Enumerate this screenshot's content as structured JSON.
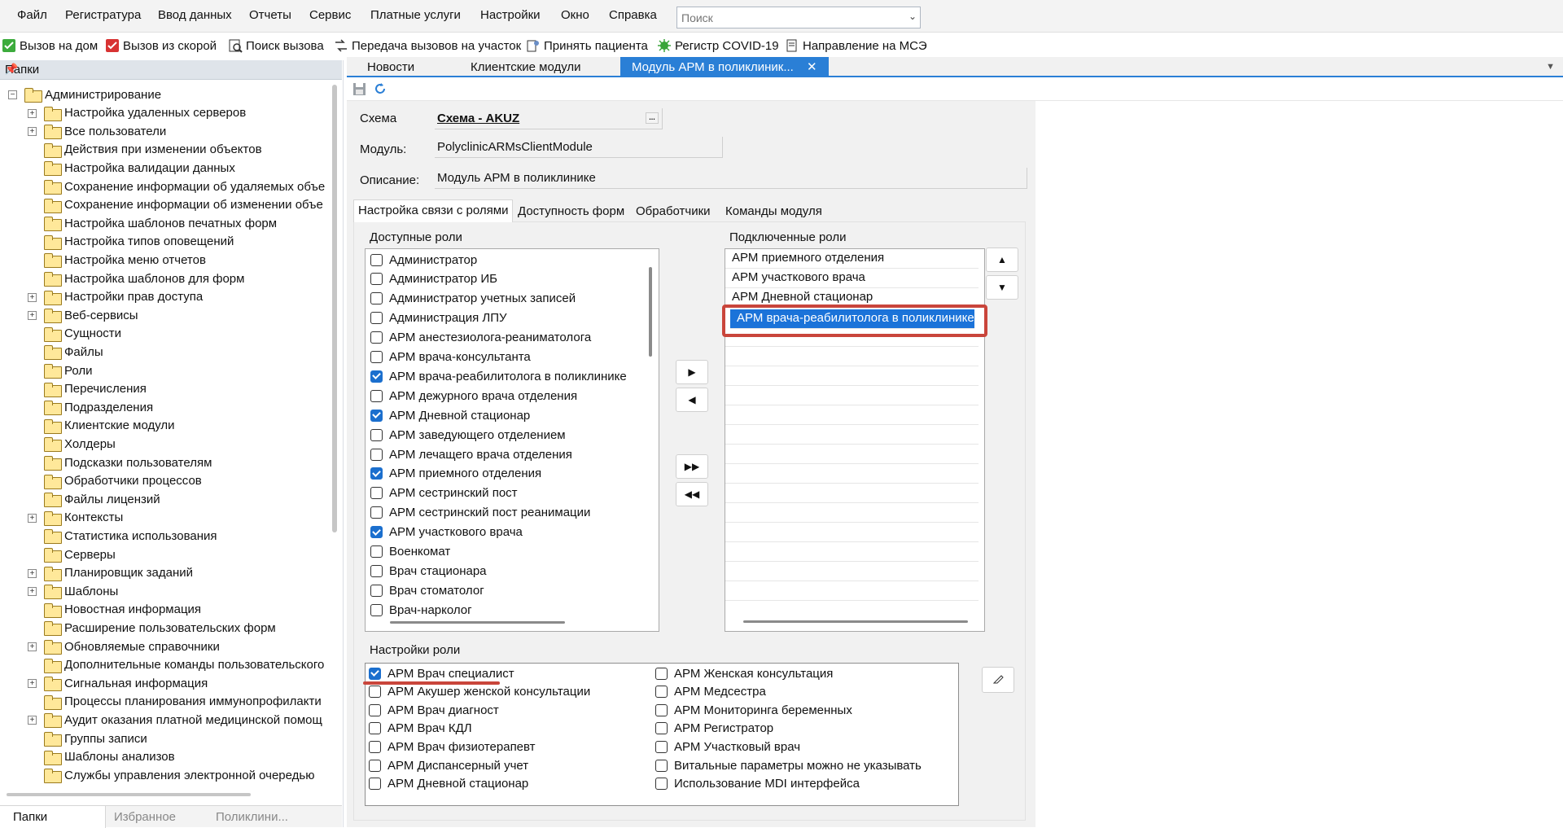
{
  "menu": [
    "Файл",
    "Регистратура",
    "Ввод данных",
    "Отчеты",
    "Сервис",
    "Платные услуги",
    "Настройки",
    "Окно",
    "Справка"
  ],
  "search": {
    "placeholder": "Поиск"
  },
  "toolbar": [
    {
      "label": "Вызов на дом",
      "icon": "house-check-icon",
      "color": "#3cab3c"
    },
    {
      "label": "Вызов из скорой",
      "icon": "ambulance-icon",
      "color": "#d83333"
    },
    {
      "label": "Поиск вызова",
      "icon": "search-document-icon",
      "color": "#3a3a3a"
    },
    {
      "label": "Передача вызовов на участок",
      "icon": "transfer-icon",
      "color": "#3a3a3a"
    },
    {
      "label": "Принять пациента",
      "icon": "accept-patient-icon",
      "color": "#3a3a3a"
    },
    {
      "label": "Регистр COVID-19",
      "icon": "virus-icon",
      "color": "#3aa53a"
    },
    {
      "label": "Направление на МСЭ",
      "icon": "referral-icon",
      "color": "#3a3a3a"
    }
  ],
  "left_panel": {
    "title": "Папки",
    "tree": [
      {
        "label": "Администрирование",
        "level": 0,
        "expander": "−"
      },
      {
        "label": "Настройка удаленных серверов",
        "level": 1,
        "expander": "+"
      },
      {
        "label": "Все пользователи",
        "level": 1,
        "expander": "+"
      },
      {
        "label": "Действия при изменении объектов",
        "level": 1,
        "expander": ""
      },
      {
        "label": "Настройка валидации данных",
        "level": 1,
        "expander": ""
      },
      {
        "label": "Сохранение информации об удаляемых объе",
        "level": 1,
        "expander": ""
      },
      {
        "label": "Сохранение информации об изменении объе",
        "level": 1,
        "expander": ""
      },
      {
        "label": "Настройка шаблонов печатных форм",
        "level": 1,
        "expander": ""
      },
      {
        "label": "Настройка типов оповещений",
        "level": 1,
        "expander": ""
      },
      {
        "label": "Настройка меню отчетов",
        "level": 1,
        "expander": ""
      },
      {
        "label": "Настройка шаблонов для форм",
        "level": 1,
        "expander": ""
      },
      {
        "label": "Настройки прав доступа",
        "level": 1,
        "expander": "+"
      },
      {
        "label": "Веб-сервисы",
        "level": 1,
        "expander": "+"
      },
      {
        "label": "Сущности",
        "level": 1,
        "expander": ""
      },
      {
        "label": "Файлы",
        "level": 1,
        "expander": ""
      },
      {
        "label": "Роли",
        "level": 1,
        "expander": ""
      },
      {
        "label": "Перечисления",
        "level": 1,
        "expander": ""
      },
      {
        "label": "Подразделения",
        "level": 1,
        "expander": ""
      },
      {
        "label": "Клиентские модули",
        "level": 1,
        "expander": ""
      },
      {
        "label": "Холдеры",
        "level": 1,
        "expander": ""
      },
      {
        "label": "Подсказки пользователям",
        "level": 1,
        "expander": ""
      },
      {
        "label": "Обработчики процессов",
        "level": 1,
        "expander": ""
      },
      {
        "label": "Файлы лицензий",
        "level": 1,
        "expander": ""
      },
      {
        "label": "Контексты",
        "level": 1,
        "expander": "+"
      },
      {
        "label": "Статистика использования",
        "level": 1,
        "expander": ""
      },
      {
        "label": "Серверы",
        "level": 1,
        "expander": ""
      },
      {
        "label": "Планировщик заданий",
        "level": 1,
        "expander": "+"
      },
      {
        "label": "Шаблоны",
        "level": 1,
        "expander": "+"
      },
      {
        "label": "Новостная информация",
        "level": 1,
        "expander": ""
      },
      {
        "label": "Расширение пользовательских форм",
        "level": 1,
        "expander": ""
      },
      {
        "label": "Обновляемые справочники",
        "level": 1,
        "expander": "+"
      },
      {
        "label": "Дополнительные команды пользовательского",
        "level": 1,
        "expander": ""
      },
      {
        "label": "Сигнальная информация",
        "level": 1,
        "expander": "+"
      },
      {
        "label": "Процессы планирования иммунопрофилакти",
        "level": 1,
        "expander": ""
      },
      {
        "label": "Аудит оказания платной медицинской помощ",
        "level": 1,
        "expander": "+"
      },
      {
        "label": "Группы записи",
        "level": 1,
        "expander": ""
      },
      {
        "label": "Шаблоны анализов",
        "level": 1,
        "expander": ""
      },
      {
        "label": "Службы управления электронной очередью",
        "level": 1,
        "expander": ""
      }
    ],
    "bottom_tabs": [
      "Папки",
      "Избранное",
      "Поликлини..."
    ]
  },
  "main_tabs": [
    {
      "label": "Новости"
    },
    {
      "label": "Клиентские модули"
    },
    {
      "label": "Модуль АРМ в поликлиник..."
    }
  ],
  "form": {
    "schema_label": "Схема",
    "schema_value": "Схема - AKUZ",
    "module_label": "Модуль:",
    "module_value": "PolyclinicARMsClientModule",
    "desc_label": "Описание:",
    "desc_value": "Модуль АРМ в поликлинике"
  },
  "inner_tabs": [
    "Настройка связи с ролями",
    "Доступность форм",
    "Обработчики",
    "Команды модуля"
  ],
  "available_roles": {
    "title": "Доступные роли",
    "items": [
      {
        "label": "Администратор",
        "checked": false
      },
      {
        "label": "Администратор ИБ",
        "checked": false
      },
      {
        "label": "Администратор учетных записей",
        "checked": false
      },
      {
        "label": "Администрация ЛПУ",
        "checked": false
      },
      {
        "label": "АРМ анестезиолога-реаниматолога",
        "checked": false
      },
      {
        "label": "АРМ врача-консультанта",
        "checked": false
      },
      {
        "label": "АРМ врача-реабилитолога в поликлинике",
        "checked": true
      },
      {
        "label": "АРМ дежурного врача отделения",
        "checked": false
      },
      {
        "label": "АРМ Дневной стационар",
        "checked": true
      },
      {
        "label": "АРМ заведующего отделением",
        "checked": false
      },
      {
        "label": "АРМ лечащего врача отделения",
        "checked": false
      },
      {
        "label": "АРМ приемного отделения",
        "checked": true
      },
      {
        "label": "АРМ сестринский пост",
        "checked": false
      },
      {
        "label": "АРМ сестринский пост реанимации",
        "checked": false
      },
      {
        "label": "АРМ участкового врача",
        "checked": true
      },
      {
        "label": "Военкомат",
        "checked": false
      },
      {
        "label": "Врач стационара",
        "checked": false
      },
      {
        "label": "Врач стоматолог",
        "checked": false
      },
      {
        "label": "Врач-нарколог",
        "checked": false
      }
    ]
  },
  "connected_roles": {
    "title": "Подключенные роли",
    "items": [
      "АРМ приемного отделения",
      "АРМ участкового врача",
      "АРМ Дневной стационар",
      "АРМ врача-реабилитолога в поликлинике"
    ],
    "selected_index": 3
  },
  "role_settings": {
    "title": "Настройки роли",
    "left": [
      {
        "label": "АРМ Врач специалист",
        "checked": true
      },
      {
        "label": "АРМ Акушер женской консультации",
        "checked": false
      },
      {
        "label": "АРМ Врач диагност",
        "checked": false
      },
      {
        "label": "АРМ Врач КДЛ",
        "checked": false
      },
      {
        "label": "АРМ Врач физиотерапевт",
        "checked": false
      },
      {
        "label": "АРМ Диспансерный учет",
        "checked": false
      },
      {
        "label": "АРМ Дневной стационар",
        "checked": false
      }
    ],
    "right": [
      {
        "label": "АРМ Женская консультация",
        "checked": false
      },
      {
        "label": "АРМ Медсестра",
        "checked": false
      },
      {
        "label": "АРМ Мониторинга беременных",
        "checked": false
      },
      {
        "label": "АРМ Регистратор",
        "checked": false
      },
      {
        "label": "АРМ Участковый врач",
        "checked": false
      },
      {
        "label": "Витальные параметры можно не указывать",
        "checked": false
      },
      {
        "label": "Использование MDI интерфейса",
        "checked": false
      }
    ]
  },
  "colors": {
    "accent": "#2a7fd6",
    "highlight": "#c9453b",
    "selection": "#1b73d9"
  }
}
